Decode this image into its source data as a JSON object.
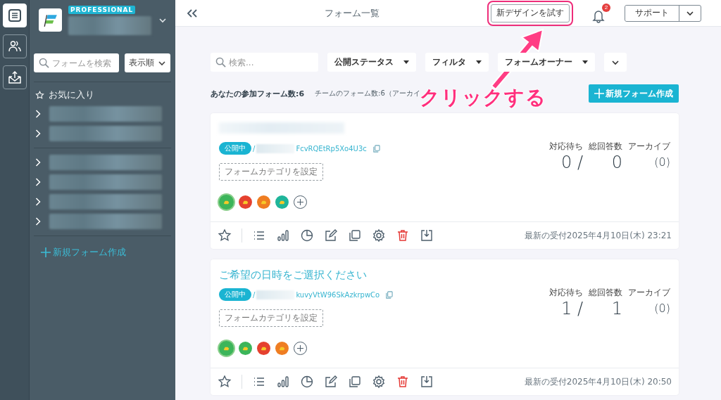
{
  "rail": {
    "items": [
      {
        "kind": "forms",
        "selected": true
      },
      {
        "kind": "team",
        "selected": false
      },
      {
        "kind": "inbox",
        "selected": false
      }
    ]
  },
  "sidebar": {
    "plan_badge": "PROFESSIONAL",
    "search": {
      "placeholder": "フォームを検索"
    },
    "sort": "表示順",
    "favorites": "お気に入り",
    "folder_groups": [
      {
        "folders": [
          {
            "expanded": false
          },
          {
            "expanded": false
          }
        ]
      },
      {
        "folders": [
          {
            "expanded": false
          },
          {
            "expanded": false
          },
          {
            "expanded": false
          },
          {
            "expanded": false
          }
        ]
      }
    ],
    "new_form": "新規フォーム作成"
  },
  "topbar": {
    "title": "フォーム一覧",
    "try_button": "新デザインを試す",
    "notifications": "2",
    "support": "サポート"
  },
  "filters": {
    "search": {
      "placeholder": "検索..."
    },
    "dropdowns": [
      "公開ステータス",
      "フィルタ",
      "フォームオーナー"
    ]
  },
  "summary": {
    "own_count": "あなたの参加フォーム数:6",
    "team_count": "チームのフォーム数:6（アーカイ",
    "create_button": "新規フォーム作成"
  },
  "forms": [
    {
      "status": "公開中",
      "url_prefix": "/",
      "url_tail": "FcvRQEtRp5Xo4U3c",
      "category": "フォームカテゴリを設定",
      "avatars": [
        {
          "color": "#3cb55a",
          "selected": true
        },
        {
          "color": "#e5412f",
          "selected": false
        },
        {
          "color": "#ef7d22",
          "selected": false
        },
        {
          "color": "#1fb59a",
          "selected": false
        }
      ],
      "pending_label": "対応待ち",
      "pending": "0",
      "separator": "/",
      "total_label": "総回答数",
      "total": "0",
      "archive_label": "アーカイブ",
      "archive": "(0)",
      "last_received": "最新の受付2025年4月10日(木) 23:21"
    },
    {
      "title": "ご希望の日時をご選択ください",
      "status": "公開中",
      "url_prefix": "/",
      "url_tail": "kuvyVtW96SkAzkrpwCo",
      "category": "フォームカテゴリを設定",
      "avatars": [
        {
          "color": "#3cb55a",
          "selected": true
        },
        {
          "color": "#3cb55a",
          "selected": false
        },
        {
          "color": "#e5412f",
          "selected": false
        },
        {
          "color": "#ef7d22",
          "selected": false
        }
      ],
      "pending_label": "対応待ち",
      "pending": "1",
      "separator": "/",
      "total_label": "総回答数",
      "total": "1",
      "archive_label": "アーカイブ",
      "archive": "(0)",
      "last_received": "最新の受付2025年4月10日(木) 20:50"
    }
  ],
  "annotation": {
    "label": "クリックする"
  }
}
